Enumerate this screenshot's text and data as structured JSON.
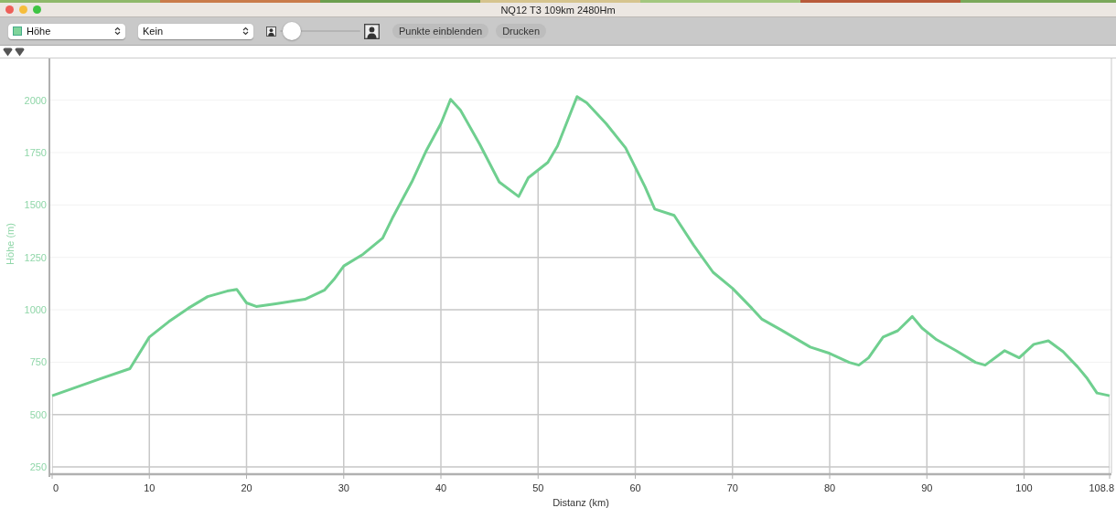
{
  "window": {
    "title": "NQ12 T3 109km 2480Hm"
  },
  "toolbar": {
    "series_select": {
      "value": "Höhe",
      "color": "#7fd49a"
    },
    "mode_select": {
      "value": "Kein"
    },
    "size_slider": {
      "level": 0.05
    },
    "buttons": [
      "Punkte einblenden",
      "Drucken"
    ]
  },
  "markers": [
    {
      "kind": "marker"
    },
    {
      "kind": "marker"
    }
  ],
  "chart": {
    "chart_data": {
      "type": "line",
      "grid": true,
      "xlabel": "Distanz (km)",
      "ylabel": "Höhe (m)",
      "xlim": [
        0,
        108.8
      ],
      "ylim": [
        220,
        2190
      ],
      "xticks": [
        0,
        10,
        20,
        30,
        40,
        50,
        60,
        70,
        80,
        90,
        100,
        {
          "value": 108.8,
          "label": "108.8"
        }
      ],
      "yticks": [
        250,
        500,
        750,
        1000,
        1250,
        1500,
        1750,
        2000
      ],
      "x": [
        0,
        5,
        8,
        10,
        12,
        14,
        16,
        18,
        19,
        20,
        21,
        23,
        26,
        28,
        29,
        30,
        32,
        34,
        35,
        37,
        38.5,
        40,
        41,
        42,
        44,
        46,
        48,
        49,
        51,
        52,
        54,
        55,
        57,
        59,
        61,
        62,
        64,
        66,
        68,
        70,
        72,
        73,
        75,
        78,
        80,
        82,
        83,
        84,
        85.5,
        87,
        88.5,
        89.5,
        91,
        93,
        95,
        96,
        98,
        99.5,
        101,
        102.5,
        104,
        105.5,
        106.5,
        107.5,
        108.8
      ],
      "series": [
        {
          "color": "#6fcf8f",
          "values": [
            590,
            672,
            719,
            870,
            943,
            1007,
            1063,
            1089,
            1097,
            1033,
            1016,
            1029,
            1050,
            1093,
            1145,
            1209,
            1265,
            1342,
            1437,
            1609,
            1760,
            1888,
            2004,
            1953,
            1789,
            1609,
            1540,
            1630,
            1703,
            1781,
            2017,
            1987,
            1888,
            1772,
            1587,
            1480,
            1450,
            1308,
            1179,
            1102,
            1007,
            956,
            904,
            822,
            792,
            749,
            736,
            771,
            870,
            900,
            968,
            913,
            857,
            805,
            749,
            736,
            805,
            771,
            835,
            852,
            801,
            728,
            672,
            603,
            590
          ]
        }
      ]
    }
  }
}
